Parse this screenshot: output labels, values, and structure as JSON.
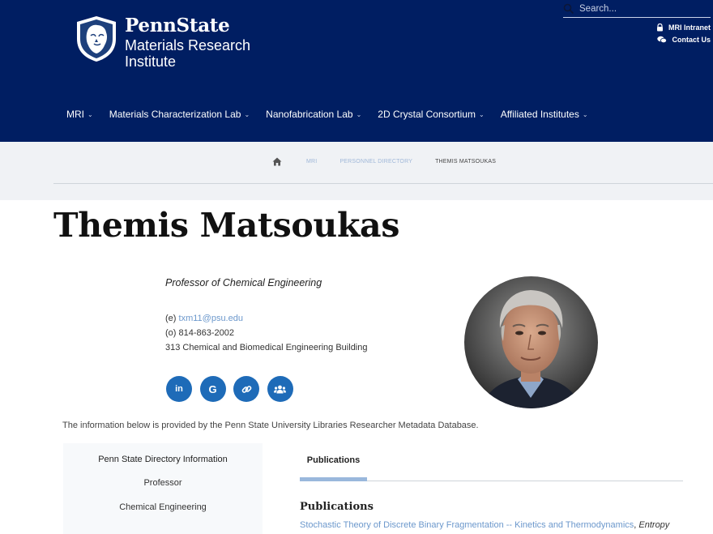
{
  "header": {
    "logo_title": "PennState",
    "logo_sub1": "Materials Research",
    "logo_sub2": "Institute",
    "search_placeholder": "Search...",
    "utility_links": [
      "MRI Intranet",
      "Contact Us"
    ],
    "nav": [
      "MRI",
      "Materials Characterization Lab",
      "Nanofabrication Lab",
      "2D Crystal Consortium",
      "Affiliated Institutes"
    ],
    "colors": {
      "header_bg": "#001e62",
      "link": "#6c98cc",
      "social_bg": "#1e6bb8"
    }
  },
  "breadcrumb": {
    "home_icon": "home-icon",
    "items": [
      "MRI",
      "PERSONNEL DIRECTORY",
      "THEMIS MATSOUKAS"
    ]
  },
  "profile": {
    "name": "Themis Matsoukas",
    "position": "Professor of Chemical Engineering",
    "email_label": "(e)",
    "email": "txm11@psu.edu",
    "office_label": "(o)",
    "phone": "814-863-2002",
    "address": "313 Chemical and Biomedical Engineering Building",
    "socials": [
      {
        "icon": "linkedin-icon",
        "glyph": "in"
      },
      {
        "icon": "google-icon",
        "glyph": "G"
      },
      {
        "icon": "link-icon",
        "glyph": ""
      },
      {
        "icon": "users-icon",
        "glyph": ""
      }
    ]
  },
  "disclaimer": "The information below is provided by the Penn State University Libraries Researcher Metadata Database.",
  "directory": {
    "title": "Penn State Directory Information",
    "lines": [
      "Professor",
      "Chemical Engineering"
    ]
  },
  "tabs": [
    "Publications"
  ],
  "publications": {
    "heading": "Publications",
    "first_title": "Stochastic Theory of Discrete Binary Fragmentation -- Kinetics and Thermodynamics",
    "first_journal": "Entropy"
  }
}
